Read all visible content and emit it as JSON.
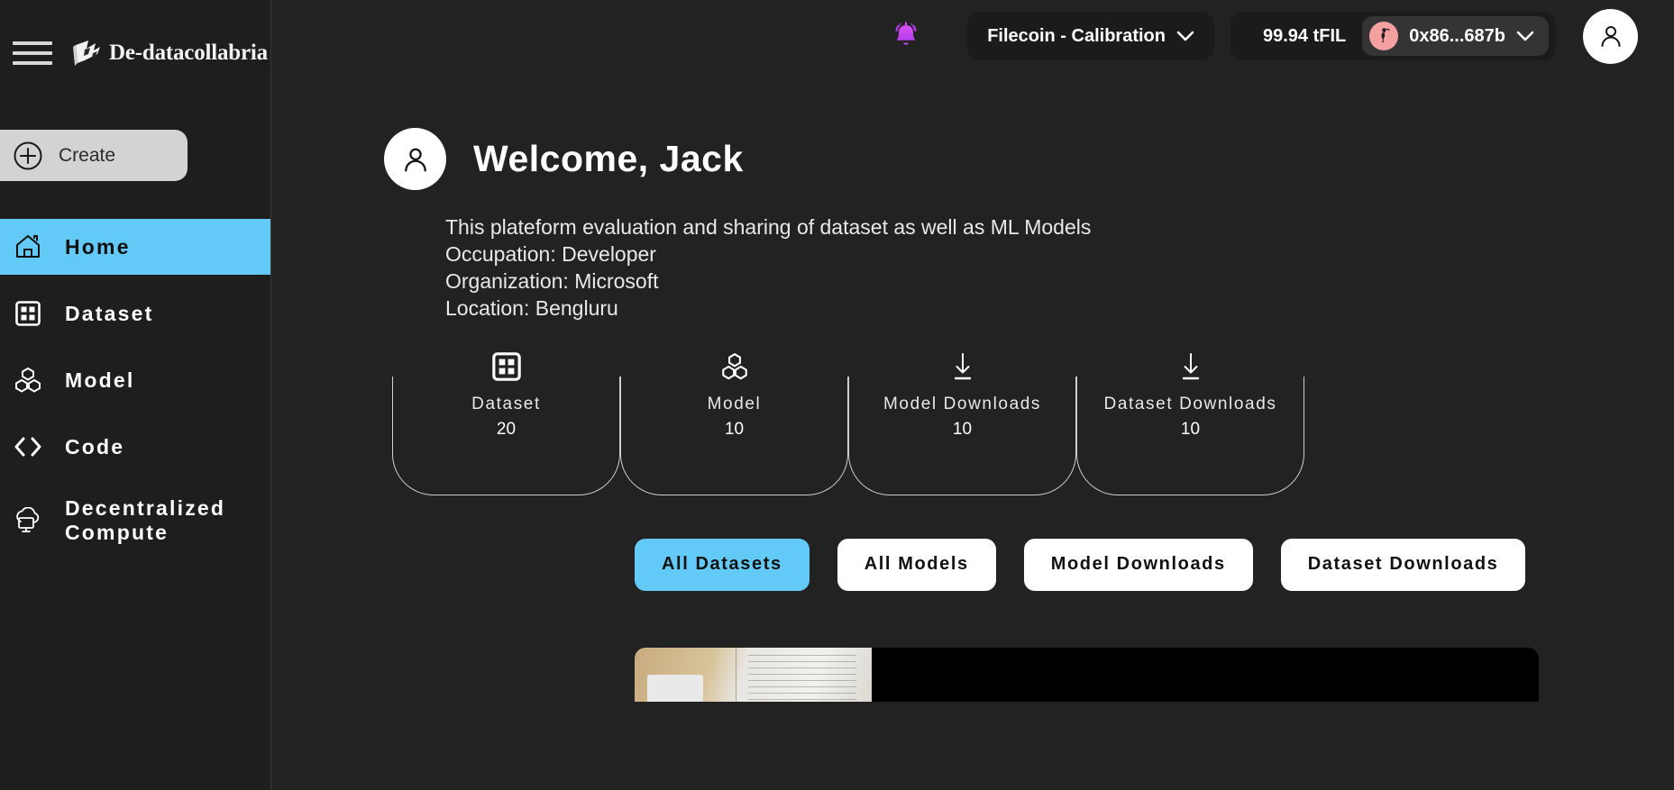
{
  "brand": {
    "name": "De-datacollabria",
    "logo_icon": "flag-logo-icon",
    "menu_icon": "hamburger-menu-icon"
  },
  "sidebar": {
    "create": {
      "label": "Create",
      "icon": "plus-circle-icon"
    },
    "items": [
      {
        "label": "Home",
        "icon": "home-icon",
        "active": true
      },
      {
        "label": "Dataset",
        "icon": "grid-icon",
        "active": false
      },
      {
        "label": "Model",
        "icon": "cubes-icon",
        "active": false
      },
      {
        "label": "Code",
        "icon": "code-brackets-icon",
        "active": false
      },
      {
        "label": "Decentralized Compute",
        "icon": "cloud-monitor-icon",
        "active": false
      }
    ]
  },
  "topbar": {
    "notifications_icon": "bell-icon",
    "network": {
      "label": "Filecoin - Calibration",
      "chevron": "chevron-down-icon"
    },
    "balance": "99.94 tFIL",
    "wallet": {
      "address": "0x86...687b",
      "avatar_icon": "flamingo-icon",
      "chevron": "chevron-down-icon"
    },
    "account_avatar_icon": "user-avatar-icon"
  },
  "main": {
    "avatar_icon": "user-avatar-icon",
    "greeting": "Welcome, Jack",
    "profile": [
      "This plateform evaluation and sharing of dataset as well as ML Models",
      "Occupation: Developer",
      "Organization: Microsoft",
      "Location: Bengluru"
    ],
    "stats": [
      {
        "label": "Dataset",
        "value": "20",
        "icon": "grid-icon"
      },
      {
        "label": "Model",
        "value": "10",
        "icon": "cubes-icon"
      },
      {
        "label": "Model Downloads",
        "value": "10",
        "icon": "download-icon"
      },
      {
        "label": "Dataset Downloads",
        "value": "10",
        "icon": "download-icon"
      }
    ],
    "filters": [
      {
        "label": "All Datasets",
        "active": true
      },
      {
        "label": "All Models",
        "active": false
      },
      {
        "label": "Model Downloads",
        "active": false
      },
      {
        "label": "Dataset Downloads",
        "active": false
      }
    ]
  },
  "colors": {
    "accent": "#63caf7",
    "page_bg": "#222222",
    "sidebar_bg": "#1e1e1e",
    "create_bg": "#d3d3d3",
    "wallet_avatar": "#f5a0a0"
  }
}
